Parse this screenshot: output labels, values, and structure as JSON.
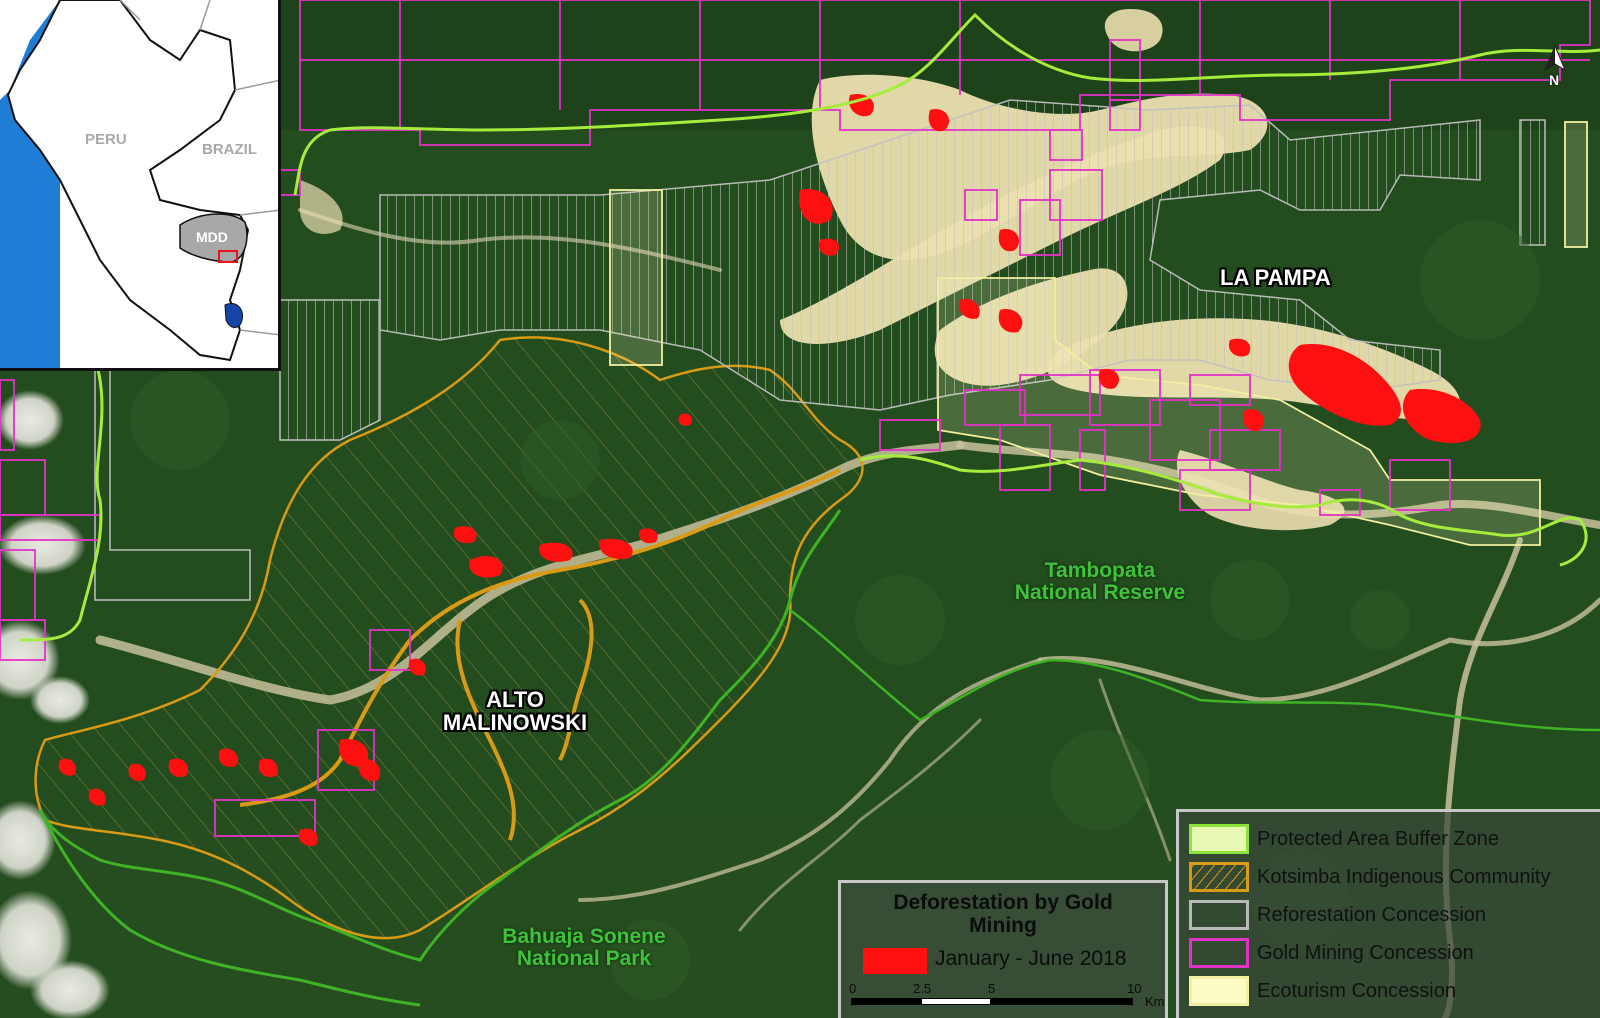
{
  "labels": {
    "la_pampa": "LA PAMPA",
    "alto_malinowski": [
      "ALTO",
      "MALINOWSKI"
    ],
    "tambopata": [
      "Tambopata",
      "National Reserve"
    ],
    "bahuaja": [
      "Bahuaja Sonene",
      "National Park"
    ]
  },
  "inset": {
    "peru": "PERU",
    "brazil": "BRAZIL",
    "mdd": "MDD"
  },
  "north_arrow": "N",
  "legend": {
    "items": [
      {
        "label": "Protected Area Buffer Zone",
        "fill": "#e8f9b4",
        "stroke": "#8ee33a"
      },
      {
        "label": "Kotsimba Indigenous Community",
        "fill": "none",
        "stroke": "#d99a16"
      },
      {
        "label": "Reforestation Concession",
        "fill": "none",
        "stroke": "#b9b9b9"
      },
      {
        "label": "Gold Mining Concession",
        "fill": "none",
        "stroke": "#e431c8"
      },
      {
        "label": "Ecoturism Concession",
        "fill": "#fdfbc4",
        "stroke": "#f2efa0"
      }
    ]
  },
  "deforestation": {
    "title": [
      "Deforestation by Gold",
      "Mining"
    ],
    "period": "January - June 2018",
    "color": "#ff1010",
    "scale_ticks": [
      "0",
      "2.5",
      "5",
      "10"
    ],
    "scale_unit": "Km"
  },
  "colors": {
    "forest": "#234c1f",
    "mining_sand": "#ecdfb0",
    "deforestation": "#ff1010",
    "buffer_zone_line": "#a6ec3d",
    "protected_area_line": "#3fb225",
    "kotsimba_line": "#d99a16",
    "gold_mining_line": "#e431c8",
    "reforestation_line": "#c0c0c0",
    "ecoturism_line": "#f2efa0"
  }
}
